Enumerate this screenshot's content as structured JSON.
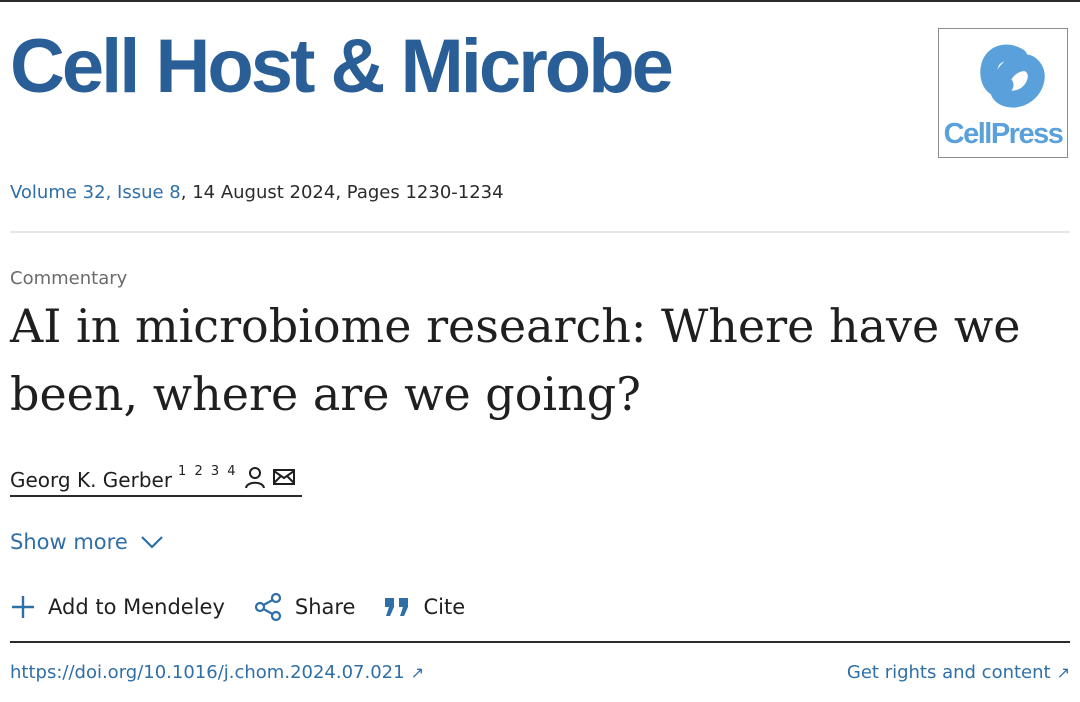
{
  "journal": {
    "title": "Cell Host & Microbe",
    "publisher_logo_text": "CellPress"
  },
  "issue": {
    "volume_issue": "Volume 32, Issue 8",
    "date_pages": ", 14 August 2024, Pages 1230-1234"
  },
  "article": {
    "type": "Commentary",
    "title": "AI in microbiome research: Where have we been, where are we going?"
  },
  "author": {
    "name": "Georg K. Gerber",
    "affiliations": "1 2 3 4",
    "icons": [
      "person-icon",
      "email-icon"
    ]
  },
  "show_more": {
    "label": "Show more",
    "icon": "chevron-down-icon"
  },
  "actions": [
    {
      "label": "Add to Mendeley",
      "icon": "plus-icon"
    },
    {
      "label": "Share",
      "icon": "share-icon"
    },
    {
      "label": "Cite",
      "icon": "quote-icon"
    }
  ],
  "links": {
    "doi": "https://doi.org/10.1016/j.chom.2024.07.021",
    "rights": "Get rights and content",
    "external_icon": "↗"
  },
  "colors": {
    "brand": "#2a5e97",
    "link": "#2e6fa8",
    "cellpress": "#5aa0da"
  }
}
